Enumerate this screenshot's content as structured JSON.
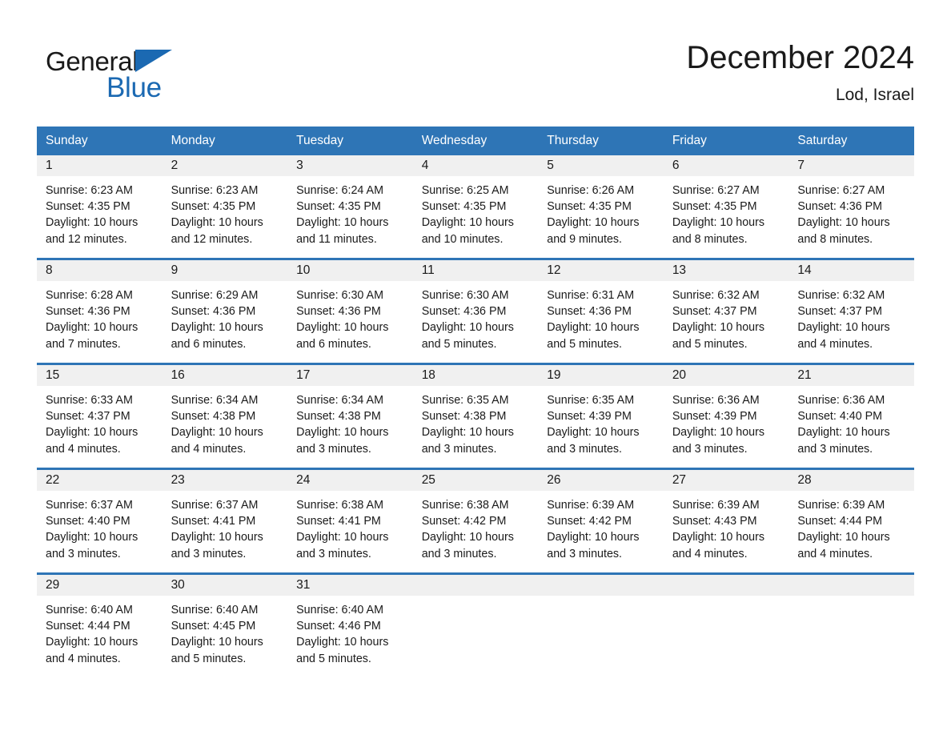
{
  "brand": {
    "name_part1": "General",
    "name_part2": "Blue",
    "accent_color": "#1B69B2",
    "triangle_icon": "triangle-icon"
  },
  "header": {
    "title": "December 2024",
    "subtitle": "Lod, Israel"
  },
  "theme": {
    "header_blue": "#2E75B6",
    "daynum_band": "#F0F0F0",
    "text": "#1A1A1A"
  },
  "weekdays": [
    "Sunday",
    "Monday",
    "Tuesday",
    "Wednesday",
    "Thursday",
    "Friday",
    "Saturday"
  ],
  "weeks": [
    [
      {
        "day": "1",
        "sunrise": "Sunrise: 6:23 AM",
        "sunset": "Sunset: 4:35 PM",
        "daylight": "Daylight: 10 hours and 12 minutes."
      },
      {
        "day": "2",
        "sunrise": "Sunrise: 6:23 AM",
        "sunset": "Sunset: 4:35 PM",
        "daylight": "Daylight: 10 hours and 12 minutes."
      },
      {
        "day": "3",
        "sunrise": "Sunrise: 6:24 AM",
        "sunset": "Sunset: 4:35 PM",
        "daylight": "Daylight: 10 hours and 11 minutes."
      },
      {
        "day": "4",
        "sunrise": "Sunrise: 6:25 AM",
        "sunset": "Sunset: 4:35 PM",
        "daylight": "Daylight: 10 hours and 10 minutes."
      },
      {
        "day": "5",
        "sunrise": "Sunrise: 6:26 AM",
        "sunset": "Sunset: 4:35 PM",
        "daylight": "Daylight: 10 hours and 9 minutes."
      },
      {
        "day": "6",
        "sunrise": "Sunrise: 6:27 AM",
        "sunset": "Sunset: 4:35 PM",
        "daylight": "Daylight: 10 hours and 8 minutes."
      },
      {
        "day": "7",
        "sunrise": "Sunrise: 6:27 AM",
        "sunset": "Sunset: 4:36 PM",
        "daylight": "Daylight: 10 hours and 8 minutes."
      }
    ],
    [
      {
        "day": "8",
        "sunrise": "Sunrise: 6:28 AM",
        "sunset": "Sunset: 4:36 PM",
        "daylight": "Daylight: 10 hours and 7 minutes."
      },
      {
        "day": "9",
        "sunrise": "Sunrise: 6:29 AM",
        "sunset": "Sunset: 4:36 PM",
        "daylight": "Daylight: 10 hours and 6 minutes."
      },
      {
        "day": "10",
        "sunrise": "Sunrise: 6:30 AM",
        "sunset": "Sunset: 4:36 PM",
        "daylight": "Daylight: 10 hours and 6 minutes."
      },
      {
        "day": "11",
        "sunrise": "Sunrise: 6:30 AM",
        "sunset": "Sunset: 4:36 PM",
        "daylight": "Daylight: 10 hours and 5 minutes."
      },
      {
        "day": "12",
        "sunrise": "Sunrise: 6:31 AM",
        "sunset": "Sunset: 4:36 PM",
        "daylight": "Daylight: 10 hours and 5 minutes."
      },
      {
        "day": "13",
        "sunrise": "Sunrise: 6:32 AM",
        "sunset": "Sunset: 4:37 PM",
        "daylight": "Daylight: 10 hours and 5 minutes."
      },
      {
        "day": "14",
        "sunrise": "Sunrise: 6:32 AM",
        "sunset": "Sunset: 4:37 PM",
        "daylight": "Daylight: 10 hours and 4 minutes."
      }
    ],
    [
      {
        "day": "15",
        "sunrise": "Sunrise: 6:33 AM",
        "sunset": "Sunset: 4:37 PM",
        "daylight": "Daylight: 10 hours and 4 minutes."
      },
      {
        "day": "16",
        "sunrise": "Sunrise: 6:34 AM",
        "sunset": "Sunset: 4:38 PM",
        "daylight": "Daylight: 10 hours and 4 minutes."
      },
      {
        "day": "17",
        "sunrise": "Sunrise: 6:34 AM",
        "sunset": "Sunset: 4:38 PM",
        "daylight": "Daylight: 10 hours and 3 minutes."
      },
      {
        "day": "18",
        "sunrise": "Sunrise: 6:35 AM",
        "sunset": "Sunset: 4:38 PM",
        "daylight": "Daylight: 10 hours and 3 minutes."
      },
      {
        "day": "19",
        "sunrise": "Sunrise: 6:35 AM",
        "sunset": "Sunset: 4:39 PM",
        "daylight": "Daylight: 10 hours and 3 minutes."
      },
      {
        "day": "20",
        "sunrise": "Sunrise: 6:36 AM",
        "sunset": "Sunset: 4:39 PM",
        "daylight": "Daylight: 10 hours and 3 minutes."
      },
      {
        "day": "21",
        "sunrise": "Sunrise: 6:36 AM",
        "sunset": "Sunset: 4:40 PM",
        "daylight": "Daylight: 10 hours and 3 minutes."
      }
    ],
    [
      {
        "day": "22",
        "sunrise": "Sunrise: 6:37 AM",
        "sunset": "Sunset: 4:40 PM",
        "daylight": "Daylight: 10 hours and 3 minutes."
      },
      {
        "day": "23",
        "sunrise": "Sunrise: 6:37 AM",
        "sunset": "Sunset: 4:41 PM",
        "daylight": "Daylight: 10 hours and 3 minutes."
      },
      {
        "day": "24",
        "sunrise": "Sunrise: 6:38 AM",
        "sunset": "Sunset: 4:41 PM",
        "daylight": "Daylight: 10 hours and 3 minutes."
      },
      {
        "day": "25",
        "sunrise": "Sunrise: 6:38 AM",
        "sunset": "Sunset: 4:42 PM",
        "daylight": "Daylight: 10 hours and 3 minutes."
      },
      {
        "day": "26",
        "sunrise": "Sunrise: 6:39 AM",
        "sunset": "Sunset: 4:42 PM",
        "daylight": "Daylight: 10 hours and 3 minutes."
      },
      {
        "day": "27",
        "sunrise": "Sunrise: 6:39 AM",
        "sunset": "Sunset: 4:43 PM",
        "daylight": "Daylight: 10 hours and 4 minutes."
      },
      {
        "day": "28",
        "sunrise": "Sunrise: 6:39 AM",
        "sunset": "Sunset: 4:44 PM",
        "daylight": "Daylight: 10 hours and 4 minutes."
      }
    ],
    [
      {
        "day": "29",
        "sunrise": "Sunrise: 6:40 AM",
        "sunset": "Sunset: 4:44 PM",
        "daylight": "Daylight: 10 hours and 4 minutes."
      },
      {
        "day": "30",
        "sunrise": "Sunrise: 6:40 AM",
        "sunset": "Sunset: 4:45 PM",
        "daylight": "Daylight: 10 hours and 5 minutes."
      },
      {
        "day": "31",
        "sunrise": "Sunrise: 6:40 AM",
        "sunset": "Sunset: 4:46 PM",
        "daylight": "Daylight: 10 hours and 5 minutes."
      },
      {
        "day": "",
        "sunrise": "",
        "sunset": "",
        "daylight": ""
      },
      {
        "day": "",
        "sunrise": "",
        "sunset": "",
        "daylight": ""
      },
      {
        "day": "",
        "sunrise": "",
        "sunset": "",
        "daylight": ""
      },
      {
        "day": "",
        "sunrise": "",
        "sunset": "",
        "daylight": ""
      }
    ]
  ]
}
